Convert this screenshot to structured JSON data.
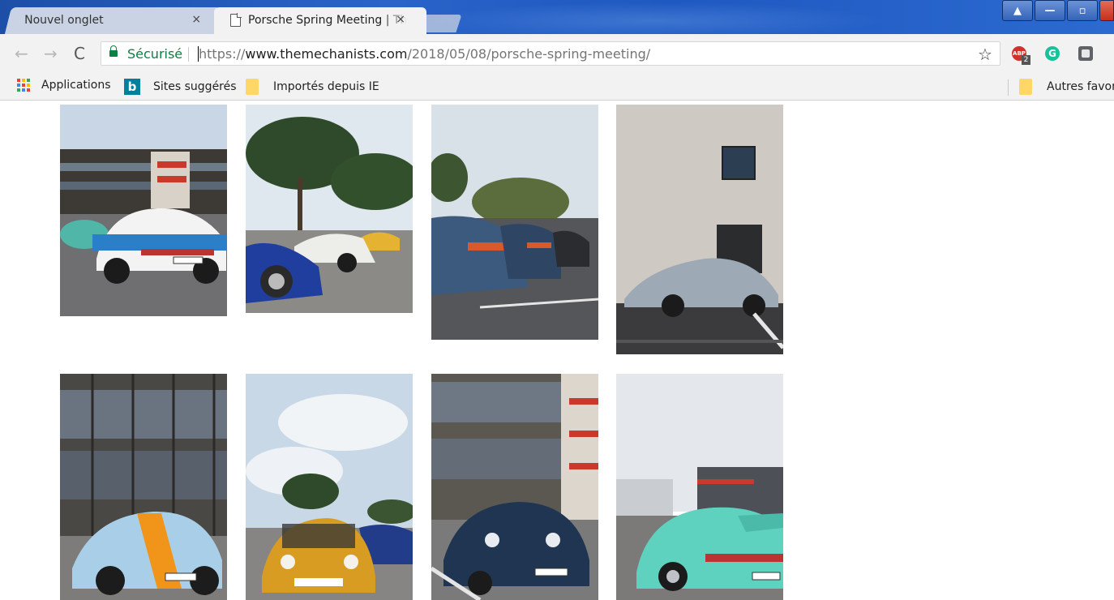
{
  "browser": {
    "tabs": [
      {
        "title": "Nouvel onglet",
        "close": "×"
      },
      {
        "title": "Porsche Spring Meeting | The Mechanists",
        "close": "×"
      }
    ],
    "window_buttons": {
      "user": "▲",
      "minimize": "—",
      "maximize": "▫"
    }
  },
  "toolbar": {
    "back": "←",
    "forward": "→",
    "reload": "C",
    "secure_label": "Sécurisé",
    "url_scheme": "https://",
    "url_host": "www.themechanists.com",
    "url_path": "/2018/05/08/porsche-spring-meeting/",
    "bookmark_star": "☆",
    "abp_label": "ABP",
    "abp_count": "2",
    "grammarly_label": "G"
  },
  "bookmarks": {
    "apps": "Applications",
    "bing_letter": "b",
    "suggested": "Sites suggérés",
    "imported": "Importés depuis IE",
    "other": "Autres favoris"
  },
  "gallery": {
    "photos": [
      {
        "subject": "white and blue 911 Carrera RS with bank of buildings and red staircase"
      },
      {
        "subject": "blue 911 and white classic Porsches under pine trees"
      },
      {
        "subject": "row of blue Porsche 928s in parking lot"
      },
      {
        "subject": "silver Porsche 356 in front of concrete wall"
      },
      {
        "subject": "Gulf-livery light blue 964 with orange stripe"
      },
      {
        "subject": "yellow classic 911 under cloudy sky"
      },
      {
        "subject": "dark blue 930 Turbo in front of office building"
      },
      {
        "subject": "mint green 964 with ducktail spoiler"
      }
    ]
  }
}
